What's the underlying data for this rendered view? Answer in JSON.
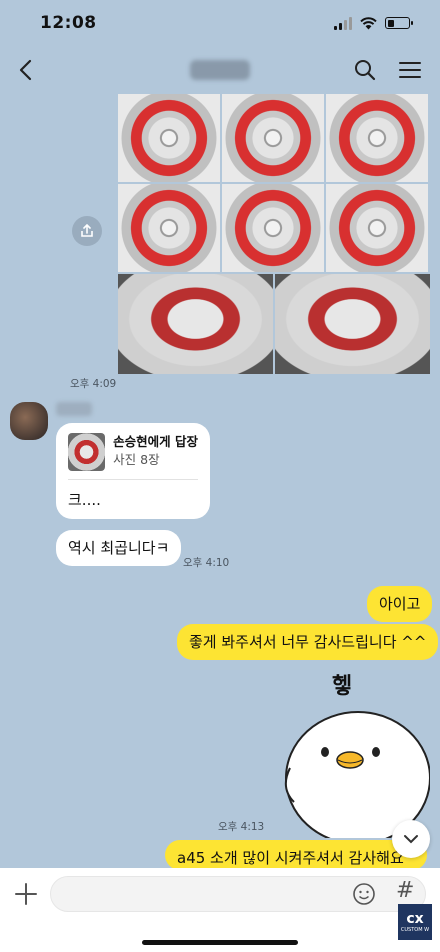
{
  "status_bar": {
    "time": "12:08"
  },
  "header": {
    "icons": [
      "back-icon",
      "search-icon",
      "menu-icon"
    ]
  },
  "photos": {
    "count": 8,
    "timestamp": "오후 4:09"
  },
  "messages": {
    "reply": {
      "target": "손승현에게 답장",
      "subtitle": "사진 8장",
      "text": "크...."
    },
    "incoming_2": "역시 최곱니다ㅋ",
    "incoming_time": "오후 4:10",
    "outgoing_1": "아이고",
    "outgoing_2": "좋게 봐주셔서 너무 감사드립니다 ^^",
    "sticker_caption": "헿",
    "outgoing_time": "오후 4:13",
    "outgoing_3": "a45 소개 많이 시켜주셔서 감사해요"
  },
  "input": {
    "placeholder": "",
    "hash_label": "#"
  },
  "watermark": {
    "logo": "cx",
    "text": "CUSTOM W"
  },
  "colors": {
    "background": "#b2c7da",
    "outgoing_bubble": "#fde433",
    "incoming_bubble": "#ffffff"
  }
}
